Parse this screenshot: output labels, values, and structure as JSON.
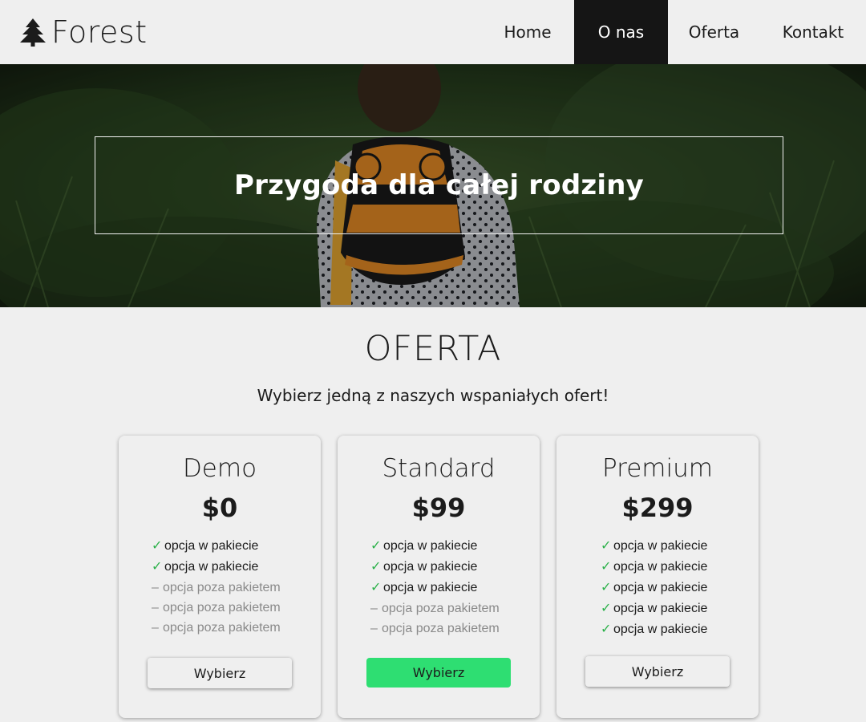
{
  "brand": {
    "name": "Forest",
    "icon": "pine-tree-icon"
  },
  "nav": {
    "items": [
      {
        "label": "Home"
      },
      {
        "label": "O nas",
        "active": true
      },
      {
        "label": "Oferta"
      },
      {
        "label": "Kontakt"
      }
    ]
  },
  "hero": {
    "title": "Przygoda dla całej rodziny"
  },
  "offer": {
    "title": "OFERTA",
    "subtitle": "Wybierz jedną z naszych wspaniałych ofert!",
    "plans": [
      {
        "name": "Demo",
        "price": "$0",
        "features": [
          {
            "mark": "✓",
            "text": "opcja w pakiecie"
          },
          {
            "mark": "✓",
            "text": "opcja w pakiecie"
          },
          {
            "mark": "–",
            "text": "opcja poza pakietem"
          },
          {
            "mark": "–",
            "text": "opcja poza pakietem"
          },
          {
            "mark": "–",
            "text": "opcja poza pakietem"
          }
        ],
        "button": "Wybierz"
      },
      {
        "name": "Standard",
        "price": "$99",
        "features": [
          {
            "mark": "✓",
            "text": "opcja w pakiecie"
          },
          {
            "mark": "✓",
            "text": "opcja w pakiecie"
          },
          {
            "mark": "✓",
            "text": "opcja w pakiecie"
          },
          {
            "mark": "–",
            "text": "opcja poza pakietem"
          },
          {
            "mark": "–",
            "text": "opcja poza pakietem"
          }
        ],
        "button": "Wybierz",
        "highlighted": true
      },
      {
        "name": "Premium",
        "price": "$299",
        "features": [
          {
            "mark": "✓",
            "text": "opcja w pakiecie"
          },
          {
            "mark": "✓",
            "text": "opcja w pakiecie"
          },
          {
            "mark": "✓",
            "text": "opcja w pakiecie"
          },
          {
            "mark": "✓",
            "text": "opcja w pakiecie"
          },
          {
            "mark": "✓",
            "text": "opcja w pakiecie"
          }
        ],
        "button": "Wybierz"
      }
    ]
  },
  "colors": {
    "background": "#efefef",
    "nav_active": "#151515",
    "check": "#2cb14a",
    "highlight_button": "#2ede72",
    "muted_text": "#8a8a8a"
  }
}
